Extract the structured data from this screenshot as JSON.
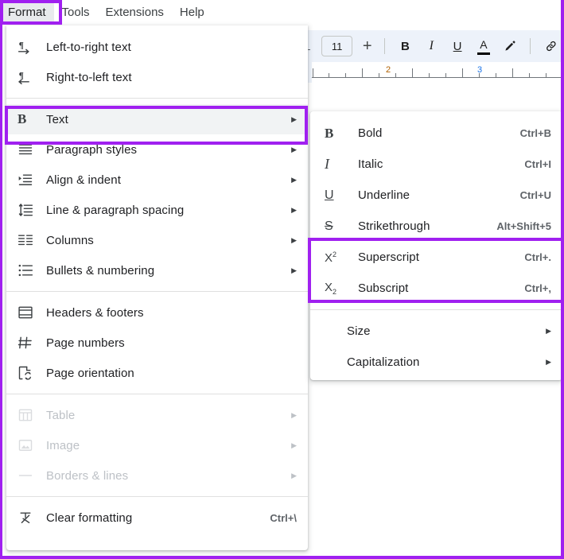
{
  "app": {
    "accent_purple": "#a020f0",
    "menu_highlight_bg": "#e8eaed",
    "selected_row_bg": "#f1f3f4",
    "toolbar_bg": "#edf2fa"
  },
  "menubar": {
    "items": [
      {
        "label": "Format",
        "active": true
      },
      {
        "label": "Tools",
        "active": false
      },
      {
        "label": "Extensions",
        "active": false
      },
      {
        "label": "Help",
        "active": false
      }
    ]
  },
  "toolbar": {
    "font_size_value": "11",
    "increase_font_label": "+",
    "bold_label": "B",
    "italic_label": "I",
    "underline_label": "U",
    "text_color_label": "A",
    "highlight_icon": "pencil-highlight-icon",
    "link_icon": "insert-link-icon"
  },
  "ruler": {
    "labels": [
      "2",
      "3"
    ],
    "label_colors": [
      "#b06000",
      "#1a73e8"
    ]
  },
  "format_menu": {
    "groups": [
      {
        "items": [
          {
            "label": "Left-to-right text",
            "icon": "paragraph-ltr-icon",
            "accel": "",
            "arrow": false,
            "disabled": false,
            "selected": false
          },
          {
            "label": "Right-to-left text",
            "icon": "paragraph-rtl-icon",
            "accel": "",
            "arrow": false,
            "disabled": false,
            "selected": false
          }
        ]
      },
      {
        "items": [
          {
            "label": "Text",
            "icon": "bold-b-icon",
            "accel": "",
            "arrow": true,
            "disabled": false,
            "selected": true
          },
          {
            "label": "Paragraph styles",
            "icon": "paragraph-styles-icon",
            "accel": "",
            "arrow": true,
            "disabled": false,
            "selected": false
          },
          {
            "label": "Align & indent",
            "icon": "align-indent-icon",
            "accel": "",
            "arrow": true,
            "disabled": false,
            "selected": false
          },
          {
            "label": "Line & paragraph spacing",
            "icon": "line-spacing-icon",
            "accel": "",
            "arrow": true,
            "disabled": false,
            "selected": false
          },
          {
            "label": "Columns",
            "icon": "columns-icon",
            "accel": "",
            "arrow": true,
            "disabled": false,
            "selected": false
          },
          {
            "label": "Bullets & numbering",
            "icon": "bullets-numbering-icon",
            "accel": "",
            "arrow": true,
            "disabled": false,
            "selected": false
          }
        ]
      },
      {
        "items": [
          {
            "label": "Headers & footers",
            "icon": "headers-footers-icon",
            "accel": "",
            "arrow": false,
            "disabled": false,
            "selected": false
          },
          {
            "label": "Page numbers",
            "icon": "page-numbers-icon",
            "accel": "",
            "arrow": false,
            "disabled": false,
            "selected": false
          },
          {
            "label": "Page orientation",
            "icon": "page-orientation-icon",
            "accel": "",
            "arrow": false,
            "disabled": false,
            "selected": false
          }
        ]
      },
      {
        "items": [
          {
            "label": "Table",
            "icon": "table-icon",
            "accel": "",
            "arrow": true,
            "disabled": true,
            "selected": false
          },
          {
            "label": "Image",
            "icon": "image-icon",
            "accel": "",
            "arrow": true,
            "disabled": true,
            "selected": false
          },
          {
            "label": "Borders & lines",
            "icon": "borders-lines-icon",
            "accel": "",
            "arrow": true,
            "disabled": true,
            "selected": false
          }
        ]
      },
      {
        "items": [
          {
            "label": "Clear formatting",
            "icon": "clear-formatting-icon",
            "accel": "Ctrl+\\",
            "arrow": false,
            "disabled": false,
            "selected": false
          }
        ]
      }
    ]
  },
  "text_submenu": {
    "groups": [
      {
        "items": [
          {
            "label": "Bold",
            "icon": "bold-icon",
            "accel": "Ctrl+B",
            "arrow": false,
            "highlighted": false
          },
          {
            "label": "Italic",
            "icon": "italic-icon",
            "accel": "Ctrl+I",
            "arrow": false,
            "highlighted": false
          },
          {
            "label": "Underline",
            "icon": "underline-icon",
            "accel": "Ctrl+U",
            "arrow": false,
            "highlighted": false
          },
          {
            "label": "Strikethrough",
            "icon": "strikethrough-icon",
            "accel": "Alt+Shift+5",
            "arrow": false,
            "highlighted": false
          },
          {
            "label": "Superscript",
            "icon": "superscript-icon",
            "accel": "Ctrl+.",
            "arrow": false,
            "highlighted": true
          },
          {
            "label": "Subscript",
            "icon": "subscript-icon",
            "accel": "Ctrl+,",
            "arrow": false,
            "highlighted": true
          }
        ]
      },
      {
        "items": [
          {
            "label": "Size",
            "icon": "",
            "accel": "",
            "arrow": true,
            "highlighted": false
          },
          {
            "label": "Capitalization",
            "icon": "",
            "accel": "",
            "arrow": true,
            "highlighted": false
          }
        ]
      }
    ]
  },
  "annotations": {
    "format_button_box": "highlight-format-menu-button",
    "text_row_box": "highlight-text-submenu-row",
    "superscript_subscript_box": "highlight-superscript-subscript"
  }
}
